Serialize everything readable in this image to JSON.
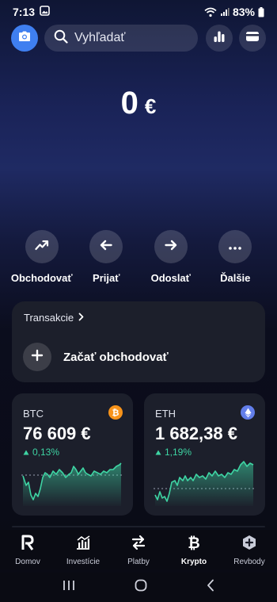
{
  "status": {
    "time": "7:13",
    "battery": "83%"
  },
  "search": {
    "placeholder": "Vyhľadať"
  },
  "balance": {
    "amount": "0",
    "currency": "€"
  },
  "actions": [
    {
      "label": "Obchodovať",
      "icon": "trend-up-icon"
    },
    {
      "label": "Prijať",
      "icon": "arrow-left-icon"
    },
    {
      "label": "Odoslať",
      "icon": "arrow-right-icon"
    },
    {
      "label": "Ďalšie",
      "icon": "more-icon"
    }
  ],
  "transactions": {
    "title": "Transakcie",
    "cta": "Začať obchodovať"
  },
  "coins": [
    {
      "symbol": "BTC",
      "price": "76 609 €",
      "change": "0,13%",
      "badge_color": "#f7931a"
    },
    {
      "symbol": "ETH",
      "price": "1 682,38 €",
      "change": "1,19%",
      "badge_color": "#627eea"
    }
  ],
  "nav": [
    {
      "label": "Domov",
      "icon": "revolut-r-icon"
    },
    {
      "label": "Investície",
      "icon": "chart-icon"
    },
    {
      "label": "Platby",
      "icon": "transfer-icon"
    },
    {
      "label": "Krypto",
      "icon": "bitcoin-icon",
      "active": true
    },
    {
      "label": "Revbody",
      "icon": "revpoints-icon"
    }
  ],
  "colors": {
    "accent": "#3f7ff0",
    "positive": "#3ed4a3",
    "card": "#1c1f2b"
  }
}
